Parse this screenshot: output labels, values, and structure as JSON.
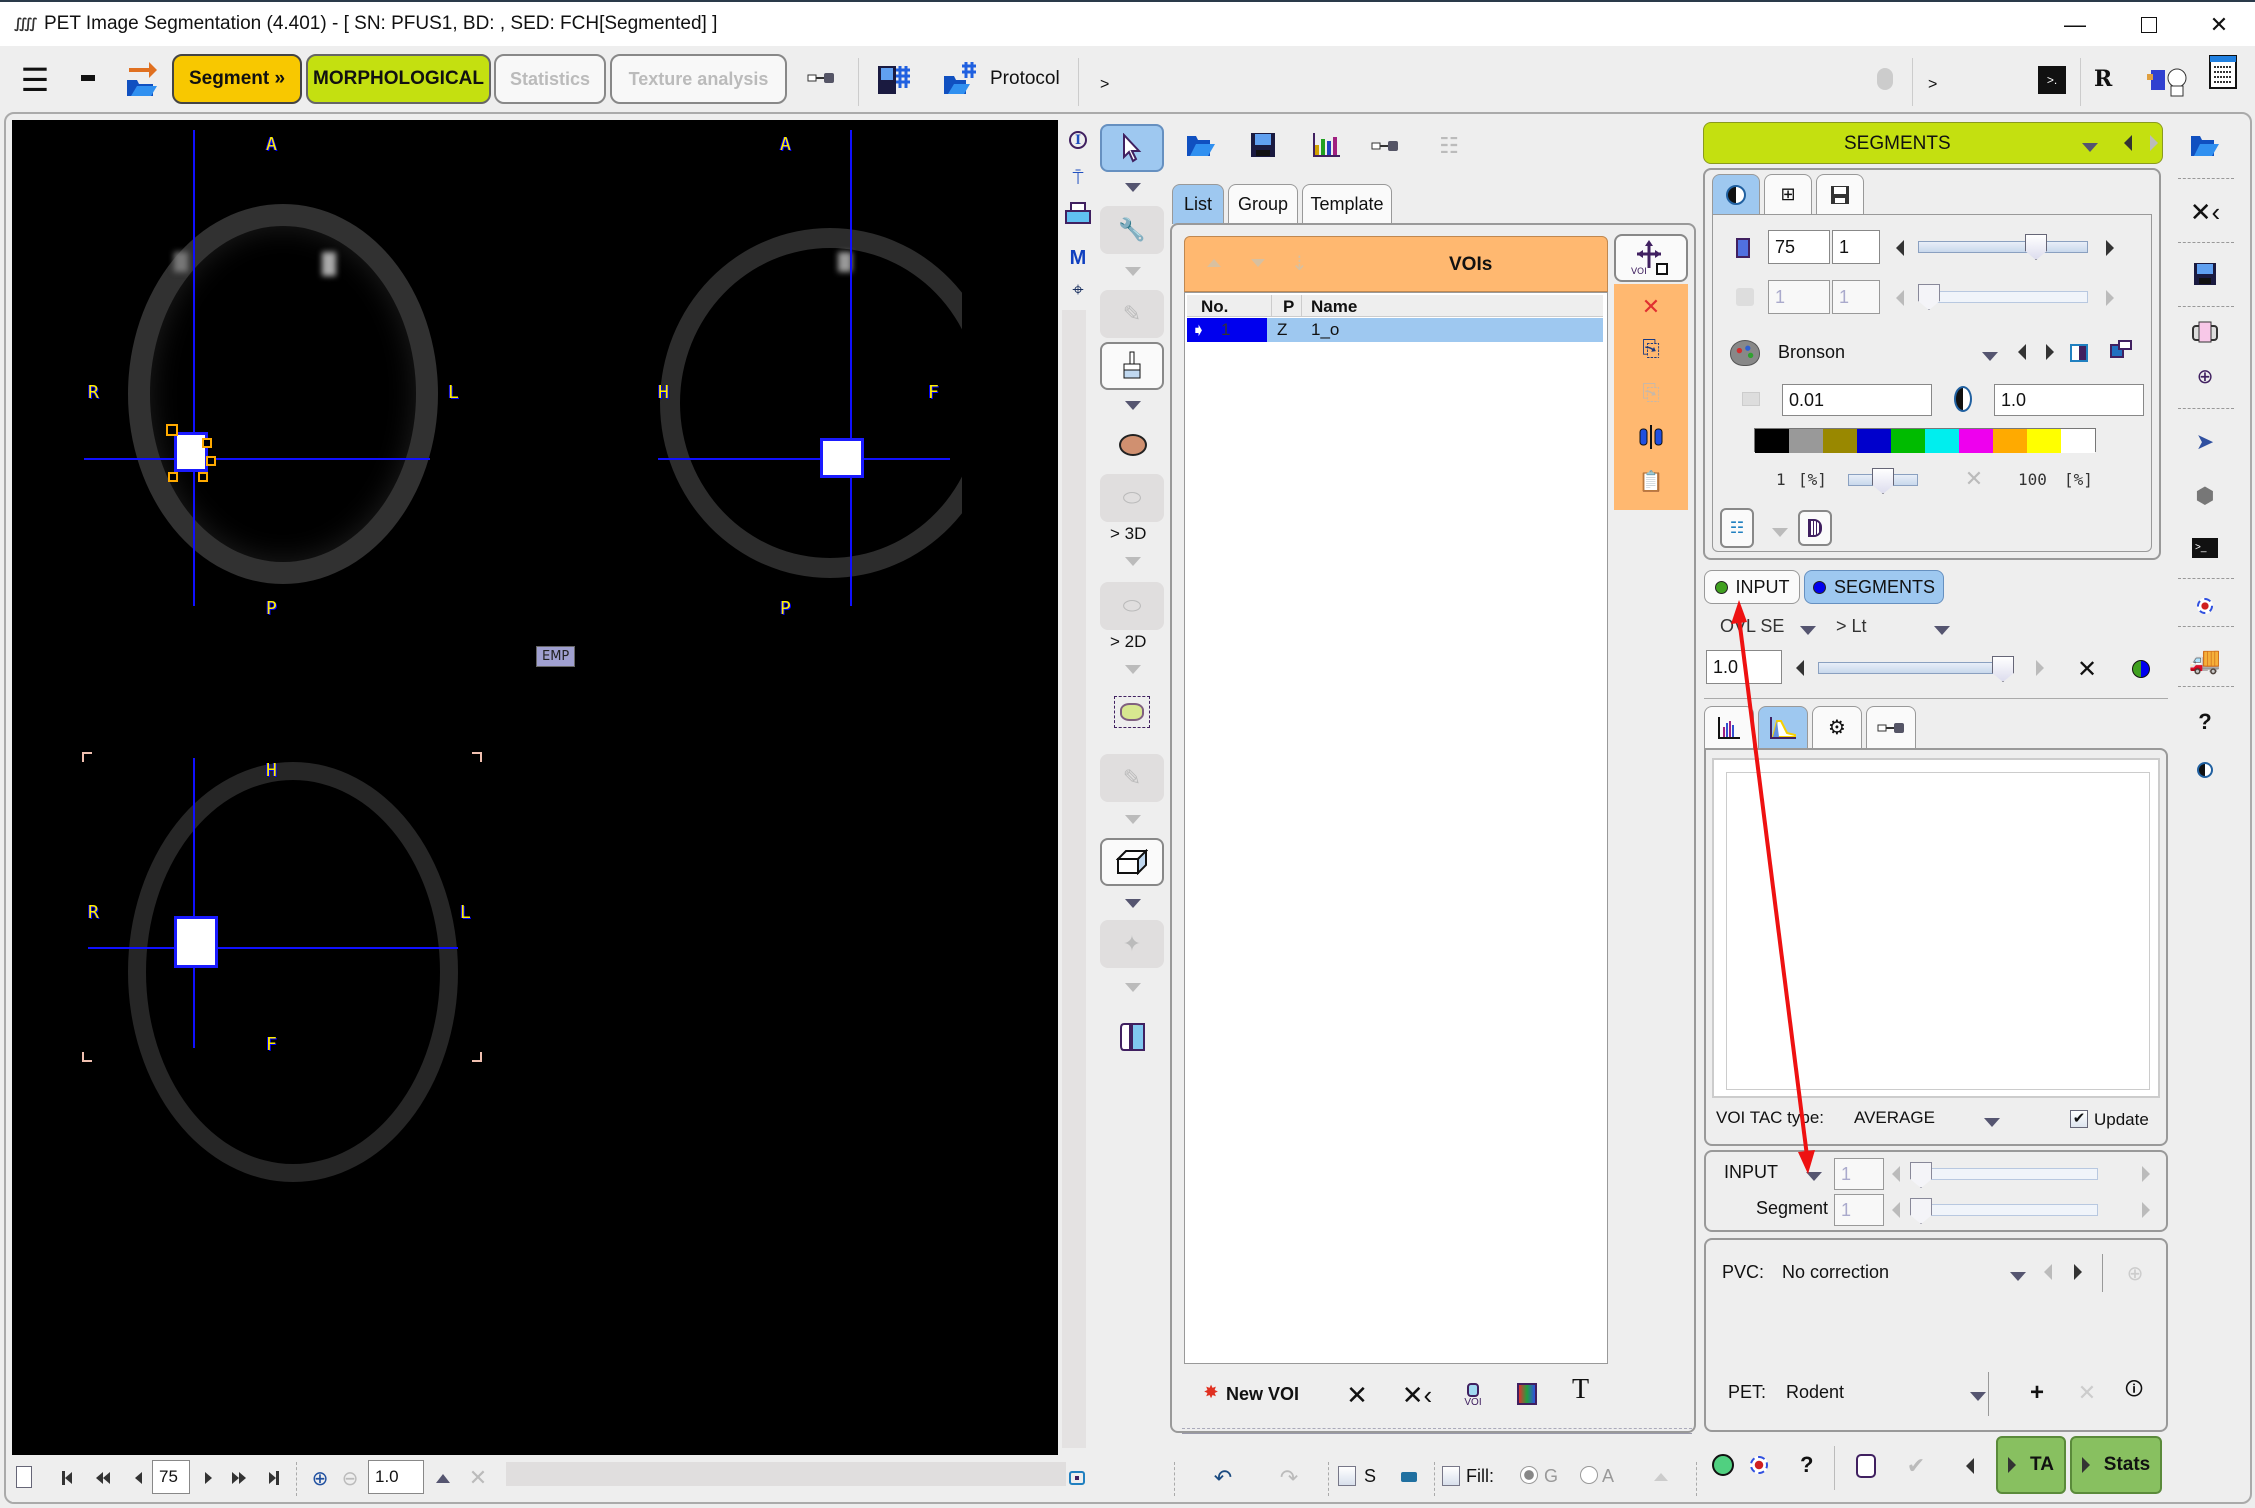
{
  "window": {
    "title": "PET Image Segmentation (4.401) - [ SN: PFUS1, BD: , SED: FCH[Segmented] ]",
    "app_icon": "pmod-logo-icon",
    "controls": [
      "minimize",
      "maximize",
      "close"
    ]
  },
  "toolbar": {
    "segment_label": "Segment »",
    "morphological_label": "MORPHOLOGICAL",
    "statistics_label": "Statistics",
    "texture_label": "Texture analysis",
    "protocol_label": "Protocol",
    "more_label": ">",
    "more_label_right": ">",
    "r_label": "R",
    "colors": {
      "segment": "#f8c800",
      "morphological": "#c4e010"
    }
  },
  "viewer": {
    "views": [
      {
        "name": "transverse",
        "top": "A",
        "bottom": "P",
        "left": "R",
        "right": "L"
      },
      {
        "name": "sagittal",
        "top": "A",
        "bottom": "P",
        "left": "H",
        "right": "F"
      },
      {
        "name": "coronal",
        "top": "H",
        "bottom": "F",
        "left": "R",
        "right": "L"
      }
    ],
    "emp_label": "EMP",
    "slice": "75",
    "zoom": "1.0"
  },
  "tools": {
    "label_3d": "> 3D",
    "label_2d": "> 2D"
  },
  "voi_panel": {
    "tabs": [
      "List",
      "Group",
      "Template"
    ],
    "active_tab": "List",
    "header": "VOIs",
    "columns": [
      "No.",
      "P",
      "Name"
    ],
    "rows": [
      {
        "no": "1",
        "p": "Z",
        "name": "1_o"
      }
    ],
    "new_voi_label": "New VOI",
    "t_label": "T",
    "s_label": "S",
    "fill_label": "Fill:",
    "radio_g": "G",
    "radio_a": "A",
    "header_color": "#ffb870"
  },
  "segments_panel": {
    "title": "SEGMENTS",
    "slice_value": "75",
    "slice_step": "1",
    "slice_fraction": 0.72,
    "frame_value": "1",
    "frame_step": "1",
    "colormap_name": "Bronson",
    "min_value": "0.01",
    "max_value": "1.0",
    "colormap_colors": [
      "#000000",
      "#999999",
      "#998800",
      "#0000cc",
      "#00bb00",
      "#00eeee",
      "#ee00ee",
      "#ffaa00",
      "#ffff00",
      "#ffffff"
    ],
    "lower_pct": "1",
    "upper_pct": "100",
    "pct_unit": "[%]",
    "pct_slider_fraction": 0.5
  },
  "overlay": {
    "input_tab": "INPUT",
    "segments_tab": "SEGMENTS",
    "input_color": "#40a020",
    "segments_color": "#0000ee",
    "ovl_label": "OVL SE",
    "lt_label": "> Lt",
    "opacity": "1.0",
    "opacity_fraction": 1.0
  },
  "tac": {
    "voi_tac_type_label": "VOI TAC type:",
    "voi_tac_type_value": "AVERAGE",
    "update_label": "Update",
    "update_checked": true
  },
  "frames": {
    "input_label": "INPUT",
    "input_value": "1",
    "segment_label": "Segment",
    "segment_value": "1"
  },
  "pvc": {
    "pvc_label": "PVC:",
    "pvc_value": "No correction",
    "pet_label": "PET:",
    "pet_value": "Rodent"
  },
  "actions": {
    "ta_label": "TA",
    "stats_label": "Stats",
    "help_label": "?"
  },
  "annotation": {
    "arrow_color": "#ee1111"
  }
}
